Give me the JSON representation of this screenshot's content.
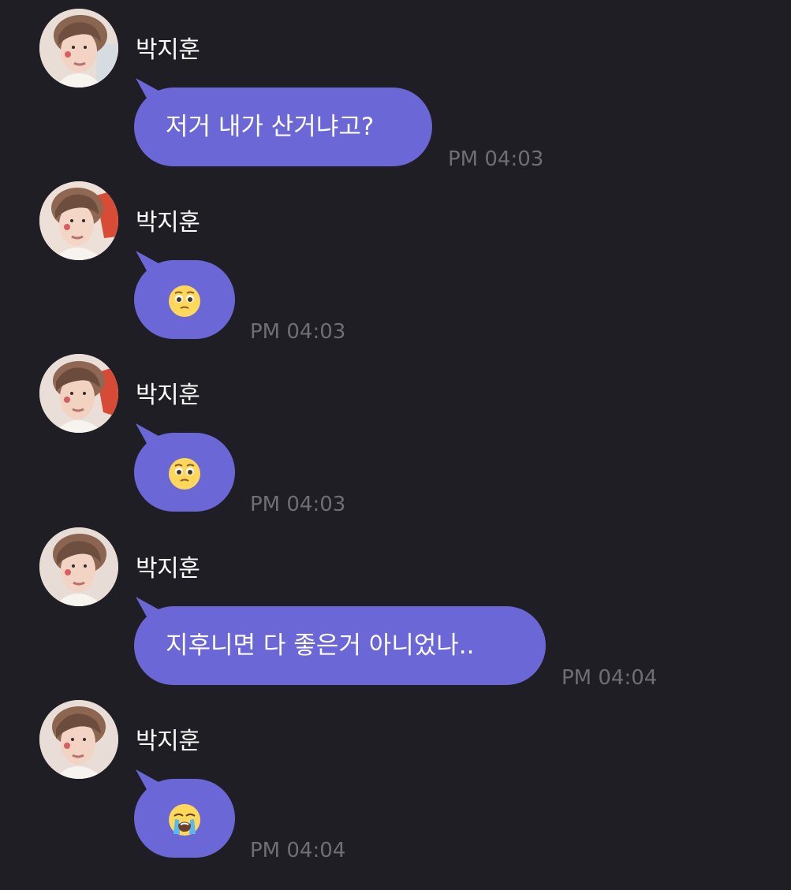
{
  "messages": [
    {
      "sender": "박지훈",
      "text": "저거 내가 산거냐고?",
      "time": "PM 04:03",
      "emoji": null
    },
    {
      "sender": "박지훈",
      "text": "",
      "time": "PM 04:03",
      "emoji": "pleading-face"
    },
    {
      "sender": "박지훈",
      "text": "",
      "time": "PM 04:03",
      "emoji": "pleading-face"
    },
    {
      "sender": "박지훈",
      "text": "지후니면 다 좋은거 아니었나..",
      "time": "PM 04:04",
      "emoji": null
    },
    {
      "sender": "박지훈",
      "text": "",
      "time": "PM 04:04",
      "emoji": "loudly-crying-face"
    }
  ],
  "colors": {
    "background": "#1f1e24",
    "bubble": "#6b67d6",
    "sender_name": "#ffffff",
    "timestamp": "#6f6e76"
  }
}
